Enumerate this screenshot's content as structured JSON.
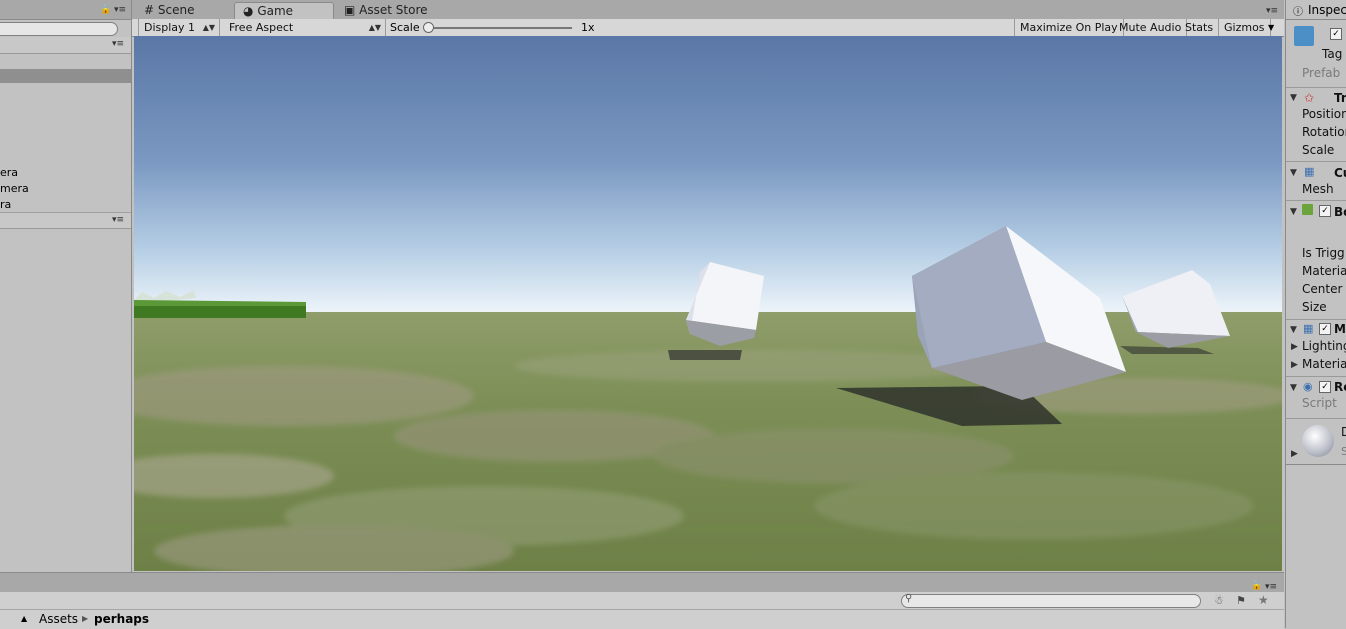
{
  "hierarchy": {
    "items": [
      {
        "label": "Main Camera",
        "visible_suffix": "era"
      },
      {
        "label": "Second Camera",
        "visible_suffix": "mera"
      },
      {
        "label": "Third Camera",
        "visible_suffix": "ra"
      }
    ]
  },
  "game_tabs": [
    {
      "label": "Scene",
      "icon": "grid-icon"
    },
    {
      "label": "Game",
      "icon": "pacman-icon"
    },
    {
      "label": "Asset Store",
      "icon": "store-icon"
    }
  ],
  "toolbar": {
    "display": "Display 1",
    "aspect": "Free Aspect",
    "scale_label": "Scale",
    "scale_value": "1x",
    "maximize": "Maximize On Play",
    "mute": "Mute Audio",
    "stats": "Stats",
    "gizmos": "Gizmos"
  },
  "inspector": {
    "title": "Inspec",
    "tag": "Tag",
    "prefab": "Prefab",
    "transform": {
      "header": "Tr",
      "position": "Position",
      "rotation": "Rotation",
      "scale": "Scale"
    },
    "mesh_filter": {
      "header": "Cu",
      "mesh": "Mesh"
    },
    "box_collider": {
      "header": "Bo",
      "is_trigger": "Is Trigg",
      "material": "Material",
      "center": "Center",
      "size": "Size"
    },
    "mesh_renderer": {
      "header": "M",
      "lighting": "Lighting",
      "materials": "Material"
    },
    "script_comp": {
      "header": "Re",
      "script": "Script"
    },
    "material_preview": {
      "name": "D",
      "shader": "S"
    }
  },
  "project": {
    "breadcrumb": [
      "Assets",
      "perhaps"
    ]
  },
  "colors": {
    "panel": "#c2c2c2",
    "tabbar": "#a8a8a8",
    "sky_top": "#5a77a6",
    "sky_horizon": "#eef5fa",
    "ground": "#7d8f57",
    "cube": "#f4f5f8"
  }
}
